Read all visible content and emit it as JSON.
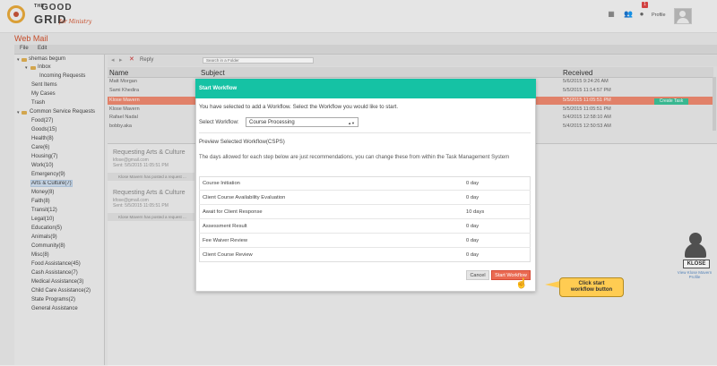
{
  "header": {
    "logo_the": "THE",
    "logo_good": "GOOD",
    "logo_grid": "GRID",
    "logo_tagline": "for Ministry",
    "notification_count": "1",
    "profile_label": "Profile"
  },
  "page_title": "Web Mail",
  "menubar": {
    "file": "File",
    "edit": "Edit"
  },
  "sidebar": {
    "user": "shemas begum",
    "inbox": "Inbox",
    "incoming_requests": "Incoming Requests",
    "sent_items": "Sent Items",
    "my_cases": "My Cases",
    "trash": "Trash",
    "common_service_requests": "Common Service Requests",
    "categories": [
      "Food(27)",
      "Goods(15)",
      "Health(8)",
      "Care(6)",
      "Housing(7)",
      "Work(10)",
      "Emergency(9)",
      "Arts & Culture(7)",
      "Money(8)",
      "Faith(8)",
      "Transit(12)",
      "Legal(10)",
      "Education(5)",
      "Animals(9)",
      "Community(8)",
      "Misc(8)",
      "Food Assistance(45)",
      "Cash Assistance(7)",
      "Medical Assistance(3)",
      "Child Care Assistance(2)",
      "State Programs(2)",
      "General Assistance"
    ]
  },
  "toolbar": {
    "reply": "Reply",
    "search_placeholder": "Search in a Folder"
  },
  "list": {
    "columns": {
      "name": "Name",
      "subject": "Subject",
      "received": "Received"
    },
    "rows": [
      {
        "name": "Matt Morgan",
        "received": "5/6/2015 9:24:26 AM"
      },
      {
        "name": "Sami Khedira",
        "received": "5/5/2015 11:14:57 PM"
      },
      {
        "name": "Klose Mavern",
        "received": "5/5/2015 11:05:51 PM"
      },
      {
        "name": "Klose Mavern",
        "received": "5/5/2015 11:05:51 PM"
      },
      {
        "name": "Rafael Nadal",
        "received": "5/4/2015 12:58:10 AM"
      },
      {
        "name": "bobby.aka",
        "received": "5/4/2015 12:50:53 AM"
      }
    ],
    "create_task": "Create Task"
  },
  "preview": {
    "items": [
      {
        "title": "Requesting Arts & Culture",
        "email": "kfose@gmail.com",
        "sent": "Sent: 5/5/2015 11:05:51 PM",
        "bar": "Klose Mavern has posted a request ..."
      },
      {
        "title": "Requesting Arts & Culture",
        "email": "kfose@gmail.com",
        "sent": "Sent: 5/5/2015 11:05:51 PM",
        "bar": "Klose Mavern has posted a request ..."
      }
    ],
    "avatar_tag": "KLOSE",
    "avatar_caption": "View Klose Mavern Profile"
  },
  "modal": {
    "title": "Start Workflow",
    "intro": "You have selected to add a Workflow. Select the Workflow you would like to start.",
    "select_label": "Select Workflow:",
    "select_value": "Course Processing",
    "preview_heading": "Preview Selected Workflow(CSPS)",
    "days_note": "The days allowed for each step below are just recommendations, you can change these from within the Task Management System",
    "steps": [
      {
        "name": "Course Initiation",
        "days": "0 day"
      },
      {
        "name": "Client Course Availability Evaluation",
        "days": "0 day"
      },
      {
        "name": "Await for Client Response",
        "days": "10 days"
      },
      {
        "name": "Assessment Result",
        "days": "0 day"
      },
      {
        "name": "Fee Waiver Review",
        "days": "0 day"
      },
      {
        "name": "Client Course Review",
        "days": "0 day"
      }
    ],
    "cancel": "Cancel",
    "start": "Start Workflow"
  },
  "callout": {
    "line1": "Click start",
    "line2": "workflow button"
  },
  "colors": {
    "accent_teal": "#15c2a4",
    "brand_orange": "#d2512c",
    "start_button": "#ea6a52",
    "callout": "#ffcc52",
    "row_highlight": "#f08a70"
  }
}
